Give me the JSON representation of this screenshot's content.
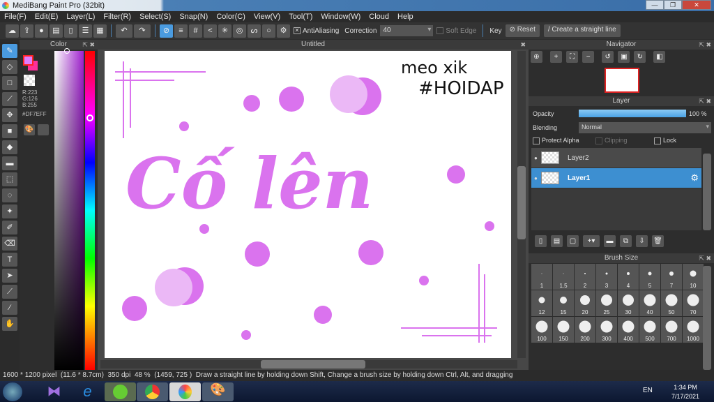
{
  "window": {
    "title": "MediBang Paint Pro (32bit)",
    "controls": [
      "—",
      "❐",
      "✕"
    ]
  },
  "menu": [
    "File(F)",
    "Edit(E)",
    "Layer(L)",
    "Filter(R)",
    "Select(S)",
    "Snap(N)",
    "Color(C)",
    "View(V)",
    "Tool(T)",
    "Window(W)",
    "Cloud",
    "Help"
  ],
  "toolbar": {
    "antialiasing_label": "AntiAliasing",
    "antialiasing_checked": true,
    "correction_label": "Correction",
    "correction_value": "40",
    "soft_edge_label": "Soft Edge",
    "key_label": "Key",
    "reset_label": "Reset",
    "straight_line_label": "Create a straight line"
  },
  "color_panel": {
    "title": "Color",
    "primary_color": "#DF7EFF",
    "secondary_color": "#FF2E9A",
    "r": "R:223",
    "g": "G:126",
    "b": "B:255",
    "hex": "#DF7EFF"
  },
  "canvas": {
    "tab": "Untitled",
    "title_text": "Cố lên",
    "signature_line1": "meo xik",
    "signature_line2": "#HOIDAP",
    "ink_color": "#DA73EE",
    "light_color": "#EBB8F6"
  },
  "navigator": {
    "title": "Navigator"
  },
  "layer_panel": {
    "title": "Layer",
    "opacity_label": "Opacity",
    "opacity_value": "100 %",
    "opacity_percent": 100,
    "blending_label": "Blending",
    "blending_value": "Normal",
    "protect_alpha": "Protect Alpha",
    "clipping": "Clipping",
    "lock": "Lock",
    "layers": [
      {
        "name": "Layer2",
        "selected": false
      },
      {
        "name": "Layer1",
        "selected": true
      }
    ]
  },
  "brush_size": {
    "title": "Brush Size",
    "sizes": [
      "1",
      "1.5",
      "2",
      "3",
      "4",
      "5",
      "7",
      "10",
      "12",
      "15",
      "20",
      "25",
      "30",
      "40",
      "50",
      "70",
      "100",
      "150",
      "200",
      "300",
      "400",
      "500",
      "700",
      "1000"
    ]
  },
  "status": {
    "size": "1600 * 1200 pixel",
    "physical": "(11.6 * 8.7cm)",
    "dpi": "350 dpi",
    "zoom": "48 %",
    "cursor": "(1459, 725 )",
    "hint": "Draw a straight line by holding down Shift, Change a brush size by holding down Ctrl, Alt, and dragging"
  },
  "taskbar": {
    "lang": "EN",
    "time": "1:34 PM",
    "date": "7/17/2021"
  }
}
